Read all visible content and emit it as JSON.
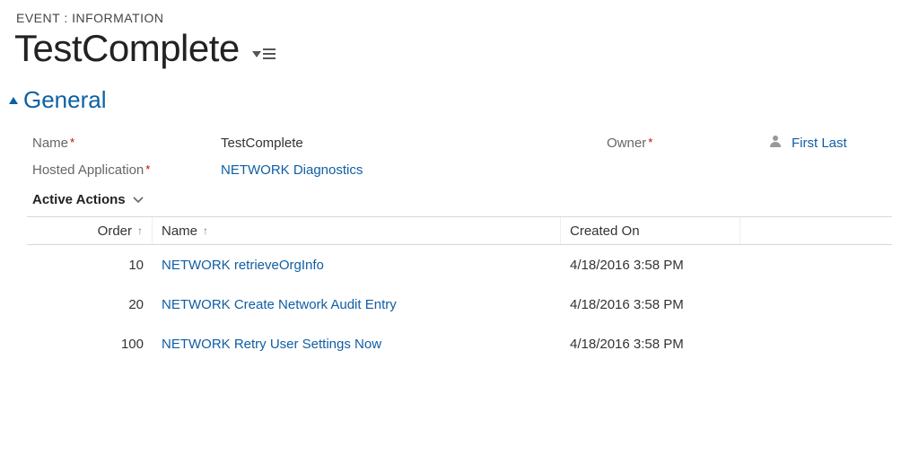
{
  "breadcrumb": "EVENT : INFORMATION",
  "title": "TestComplete",
  "section": {
    "title": "General"
  },
  "fields": {
    "name": {
      "label": "Name",
      "value": "TestComplete"
    },
    "owner": {
      "label": "Owner",
      "value": "First Last"
    },
    "hostedApp": {
      "label": "Hosted Application",
      "value": "NETWORK Diagnostics"
    }
  },
  "subgrid": {
    "label": "Active Actions",
    "columns": {
      "order": "Order",
      "name": "Name",
      "createdOn": "Created On"
    },
    "rows": [
      {
        "order": "10",
        "name": "NETWORK retrieveOrgInfo",
        "createdOn": "4/18/2016 3:58 PM"
      },
      {
        "order": "20",
        "name": "NETWORK Create Network Audit Entry",
        "createdOn": "4/18/2016 3:58 PM"
      },
      {
        "order": "100",
        "name": "NETWORK Retry User Settings Now",
        "createdOn": "4/18/2016 3:58 PM"
      }
    ]
  }
}
